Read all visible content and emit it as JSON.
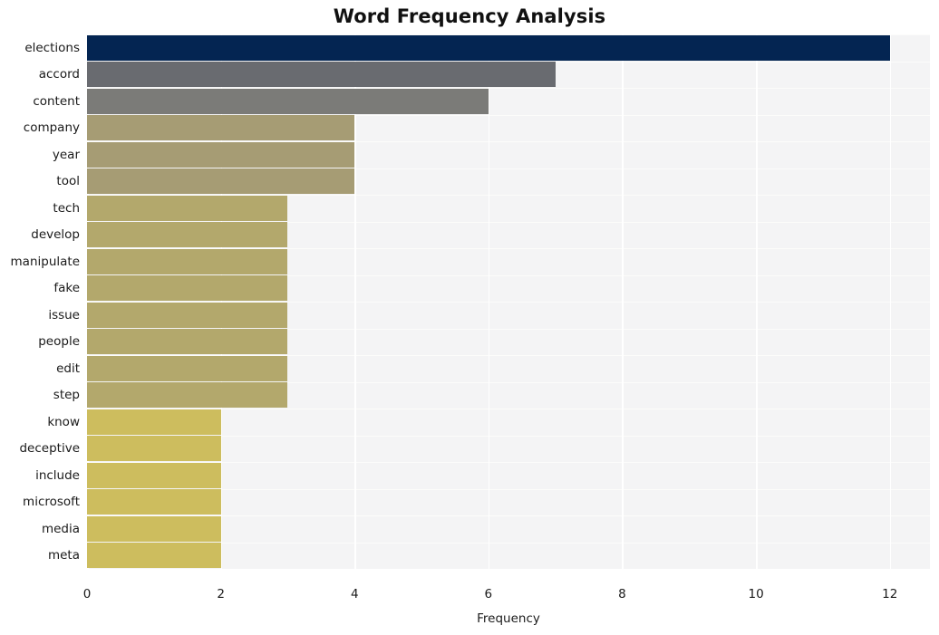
{
  "chart_data": {
    "type": "bar",
    "orientation": "horizontal",
    "title": "Word Frequency Analysis",
    "xlabel": "Frequency",
    "ylabel": "",
    "xlim": [
      0,
      12.6
    ],
    "xticks": [
      0,
      2,
      4,
      6,
      8,
      10,
      12
    ],
    "xtick_labels": [
      "0",
      "2",
      "4",
      "6",
      "8",
      "10",
      "12"
    ],
    "grid": true,
    "grid_color": "#ffffff",
    "plot_background": "#f4f4f5",
    "figure_background": "#ffffff",
    "legend": null,
    "categories": [
      "elections",
      "accord",
      "content",
      "company",
      "year",
      "tool",
      "tech",
      "develop",
      "manipulate",
      "fake",
      "issue",
      "people",
      "edit",
      "step",
      "know",
      "deceptive",
      "include",
      "microsoft",
      "media",
      "meta"
    ],
    "values": [
      12,
      7,
      6,
      4,
      4,
      4,
      3,
      3,
      3,
      3,
      3,
      3,
      3,
      3,
      2,
      2,
      2,
      2,
      2,
      2
    ],
    "bar_colors": [
      "#042552",
      "#696b70",
      "#7b7b78",
      "#a69c74",
      "#a69c74",
      "#a69c74",
      "#b3a86c",
      "#b3a86c",
      "#b3a86c",
      "#b3a86c",
      "#b3a86c",
      "#b3a86c",
      "#b3a86c",
      "#b3a86c",
      "#cdbd5e",
      "#cdbd5e",
      "#cdbd5e",
      "#cdbd5e",
      "#cdbd5e",
      "#cdbd5e"
    ]
  }
}
